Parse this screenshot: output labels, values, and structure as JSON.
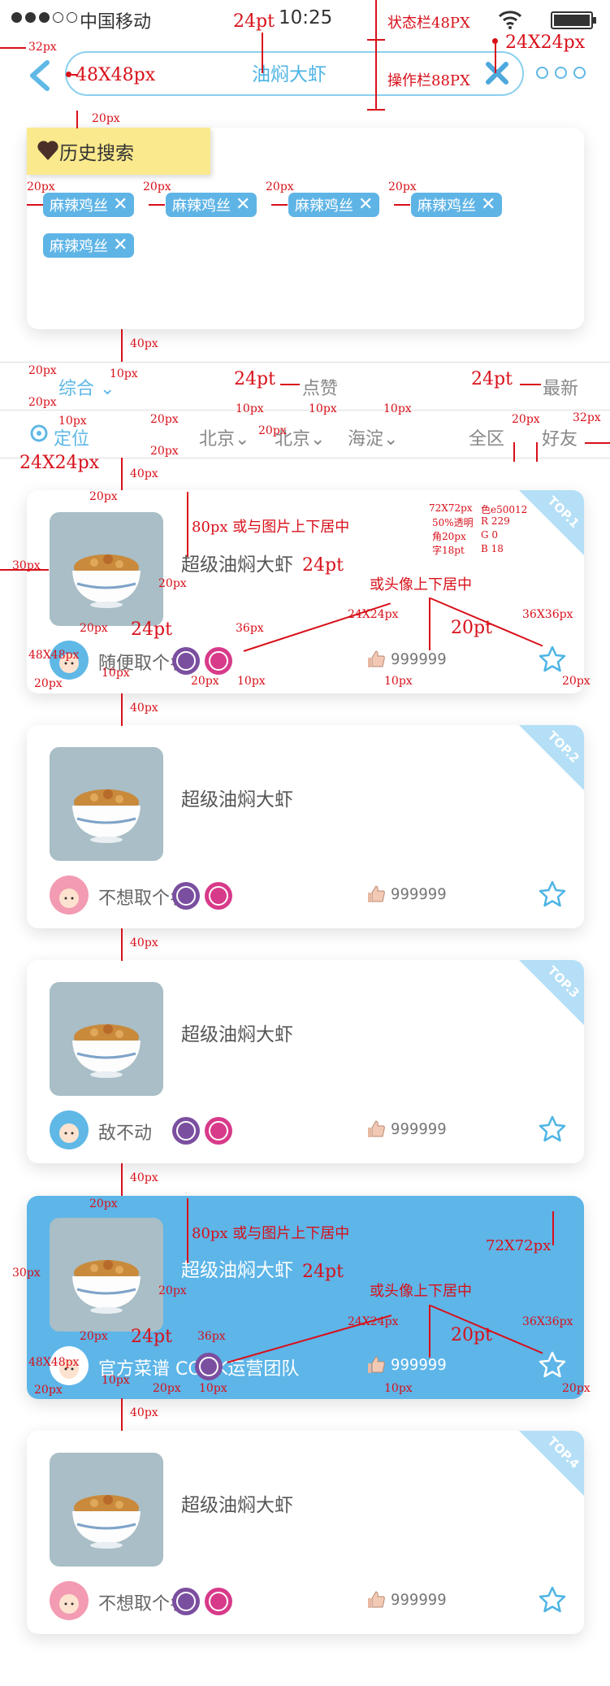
{
  "status": {
    "carrier": "中国移动",
    "time": "10:25"
  },
  "nav": {
    "title": "油焖大虾"
  },
  "history": {
    "title": "历史搜索",
    "chips": [
      "麻辣鸡丝",
      "麻辣鸡丝",
      "麻辣鸡丝",
      "麻辣鸡丝",
      "麻辣鸡丝"
    ]
  },
  "sort": {
    "comprehensive": "综合",
    "likes": "点赞",
    "latest": "最新"
  },
  "filters": {
    "location": "定位",
    "city": "北京",
    "district1": "北京",
    "district2": "海淀",
    "all_area": "全区",
    "friends": "好友"
  },
  "cards": [
    {
      "rank": "TOP.1",
      "title": "超级油焖大虾",
      "user": "随便取个名",
      "likes": "999999",
      "highlight": false
    },
    {
      "rank": "TOP.2",
      "title": "超级油焖大虾",
      "user": "不想取个名",
      "likes": "999999",
      "highlight": false
    },
    {
      "rank": "TOP.3",
      "title": "超级油焖大虾",
      "user": "敌不动",
      "likes": "999999",
      "highlight": false
    },
    {
      "rank": "",
      "title": "超级油焖大虾",
      "user": "官方菜谱 COOK运营团队",
      "likes": "999999",
      "highlight": true
    },
    {
      "rank": "TOP.4",
      "title": "超级油焖大虾",
      "user": "不想取个名",
      "likes": "999999",
      "highlight": false
    }
  ],
  "annotations": {
    "status_bar": "状态栏48PX",
    "action_bar": "操作栏88PX",
    "font24": "24pt",
    "icon24": "24X24px",
    "px32": "32px",
    "icon48": "48X48px",
    "px20": "20px",
    "px40": "40px",
    "px10": "10px",
    "px30": "30px",
    "px36": "36px",
    "pt20": "20pt",
    "icon36": "36X36px",
    "img_size": "72X72px",
    "img_note": "50%透明",
    "corner_note": "角20px",
    "font_note": "字18pt",
    "color_hex": "色e50012",
    "r": "R 229",
    "g": "G 0",
    "b": "B 18",
    "center_img": "80px 或与图片上下居中",
    "center_avatar": "或头像上下居中"
  },
  "colors": {
    "accent": "#5fb8e6",
    "highlight_card": "#5db5e8",
    "annotation": "#d8101a",
    "history_tag": "#fbe98d"
  }
}
